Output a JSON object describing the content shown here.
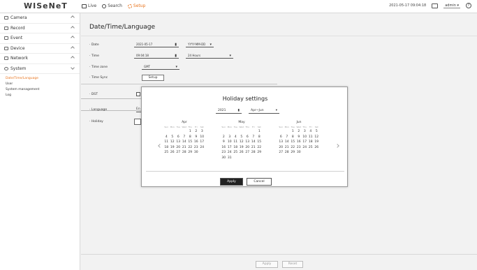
{
  "app": {
    "logo": "WISeNeT",
    "nav": [
      {
        "label": "Live",
        "icon": "live-icon"
      },
      {
        "label": "Search",
        "icon": "search-icon"
      },
      {
        "label": "Setup",
        "icon": "gear-icon"
      }
    ],
    "datetime": "2021-05-17 09:04:18",
    "user": "admin",
    "accent_color": "#e8731c"
  },
  "sidebar": {
    "items": [
      {
        "label": "Camera",
        "icon": "camera-icon",
        "expanded": false
      },
      {
        "label": "Record",
        "icon": "record-icon",
        "expanded": false
      },
      {
        "label": "Event",
        "icon": "event-icon",
        "expanded": false
      },
      {
        "label": "Device",
        "icon": "device-icon",
        "expanded": false
      },
      {
        "label": "Network",
        "icon": "network-icon",
        "expanded": false
      },
      {
        "label": "System",
        "icon": "gear-icon",
        "expanded": true
      }
    ],
    "submenu": [
      "Date/Time/Language",
      "User",
      "System management",
      "Log"
    ]
  },
  "page": {
    "title": "Date/Time/Language",
    "date_label": "Date",
    "date_value": "2021-05-17",
    "date_format": "YYYY-MM-DD",
    "time_label": "Time",
    "time_value": "09:04:18",
    "time_format": "24 Hours",
    "timezone_label": "Time zone",
    "timezone_value": "GMT",
    "timesync_label": "Time Sync",
    "timesync_button": "Setup",
    "dst_label": "DST",
    "language_label": "Language",
    "language_value": "En",
    "holiday_label": "Holiday"
  },
  "footer": {
    "apply": "Apply",
    "reset": "Reset"
  },
  "modal": {
    "title": "Holiday settings",
    "year": "2021",
    "range": "Apr~Jun",
    "dow": [
      "Sun",
      "Mon",
      "Tue",
      "Wed",
      "Thu",
      "Fri",
      "Sat"
    ],
    "months": [
      {
        "name": "Apr",
        "days": [
          "",
          "",
          "",
          "",
          "1",
          "2",
          "3",
          "4",
          "5",
          "6",
          "7",
          "8",
          "9",
          "10",
          "11",
          "12",
          "13",
          "14",
          "15",
          "16",
          "17",
          "18",
          "19",
          "20",
          "21",
          "22",
          "23",
          "24",
          "25",
          "26",
          "27",
          "28",
          "29",
          "30"
        ]
      },
      {
        "name": "May",
        "days": [
          "",
          "",
          "",
          "",
          "",
          "",
          "1",
          "2",
          "3",
          "4",
          "5",
          "6",
          "7",
          "8",
          "9",
          "10",
          "11",
          "12",
          "13",
          "14",
          "15",
          "16",
          "17",
          "18",
          "19",
          "20",
          "21",
          "22",
          "23",
          "24",
          "25",
          "26",
          "27",
          "28",
          "29",
          "30",
          "31"
        ]
      },
      {
        "name": "Jun",
        "days": [
          "",
          "",
          "1",
          "2",
          "3",
          "4",
          "5",
          "6",
          "7",
          "8",
          "9",
          "10",
          "11",
          "12",
          "13",
          "14",
          "15",
          "16",
          "17",
          "18",
          "19",
          "20",
          "21",
          "22",
          "23",
          "24",
          "25",
          "26",
          "27",
          "28",
          "29",
          "30"
        ]
      }
    ],
    "apply": "Apply",
    "cancel": "Cancel"
  }
}
